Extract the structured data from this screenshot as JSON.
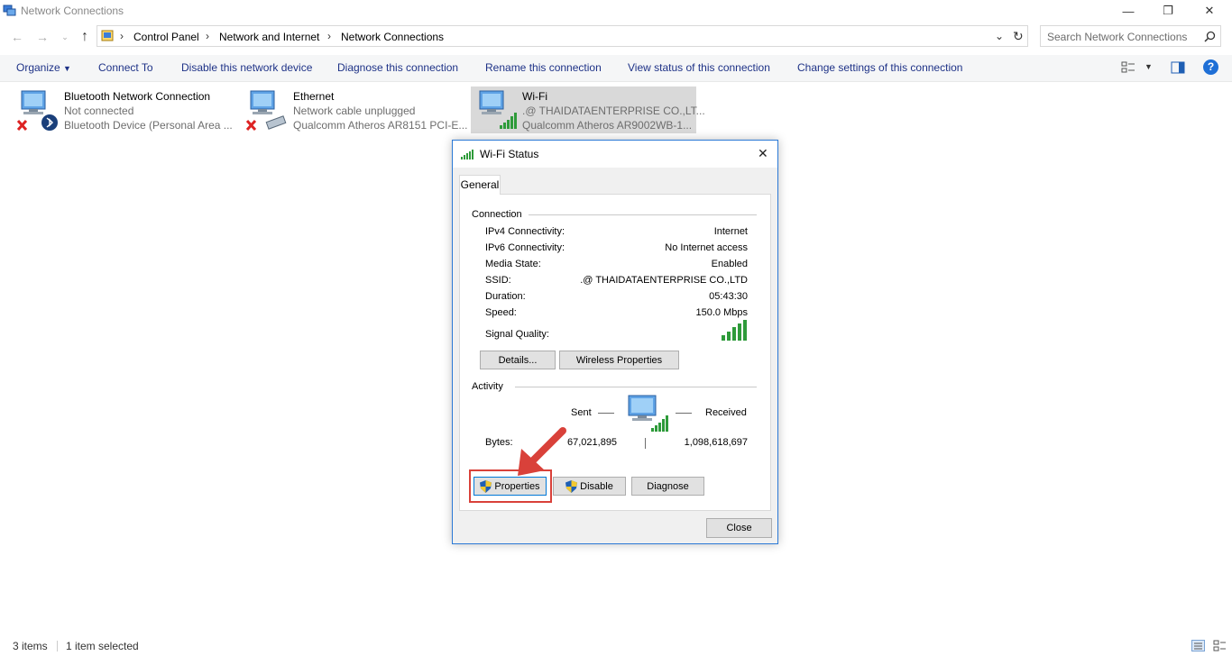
{
  "window": {
    "title": "Network Connections",
    "minimize_glyph": "—",
    "maximize_glyph": "❐",
    "close_glyph": "✕"
  },
  "address": {
    "crumbs": [
      "Control Panel",
      "Network and Internet",
      "Network Connections"
    ],
    "separator": "›",
    "search_placeholder": "Search Network Connections"
  },
  "toolbar": {
    "organize": "Organize",
    "connect_to": "Connect To",
    "disable": "Disable this network device",
    "diagnose": "Diagnose this connection",
    "rename": "Rename this connection",
    "view_status": "View status of this connection",
    "change_settings": "Change settings of this connection",
    "help_glyph": "?"
  },
  "connections": [
    {
      "name": "Bluetooth Network Connection",
      "status": "Not connected",
      "device": "Bluetooth Device (Personal Area ..."
    },
    {
      "name": "Ethernet",
      "status": "Network cable unplugged",
      "device": "Qualcomm Atheros AR8151 PCI-E..."
    },
    {
      "name": "Wi-Fi",
      "status": ".@ THAIDATAENTERPRISE CO.,LT...",
      "device": "Qualcomm Atheros AR9002WB-1..."
    }
  ],
  "dialog": {
    "title": "Wi-Fi Status",
    "close_glyph": "✕",
    "tab": "General",
    "connection_header": "Connection",
    "rows": [
      {
        "label": "IPv4 Connectivity:",
        "value": "Internet"
      },
      {
        "label": "IPv6 Connectivity:",
        "value": "No Internet access"
      },
      {
        "label": "Media State:",
        "value": "Enabled"
      },
      {
        "label": "SSID:",
        "value": ".@ THAIDATAENTERPRISE CO.,LTD"
      },
      {
        "label": "Duration:",
        "value": "05:43:30"
      },
      {
        "label": "Speed:",
        "value": "150.0 Mbps"
      }
    ],
    "signal_label": "Signal Quality:",
    "details_btn": "Details...",
    "wireless_btn": "Wireless Properties",
    "activity_header": "Activity",
    "sent_label": "Sent",
    "received_label": "Received",
    "bytes_label": "Bytes:",
    "bytes_sent": "67,021,895",
    "bytes_received": "1,098,618,697",
    "properties_btn": "Properties",
    "disable_btn": "Disable",
    "diagnose_btn": "Diagnose",
    "close_btn": "Close"
  },
  "statusbar": {
    "items_count": "3 items",
    "selected": "1 item selected"
  },
  "colors": {
    "toolbar_link": "#1e3287",
    "selection_bg": "#d9d9d9",
    "highlight_red": "#d9413a",
    "dialog_border": "#2b79d6",
    "signal_green": "#2e9b3a"
  }
}
